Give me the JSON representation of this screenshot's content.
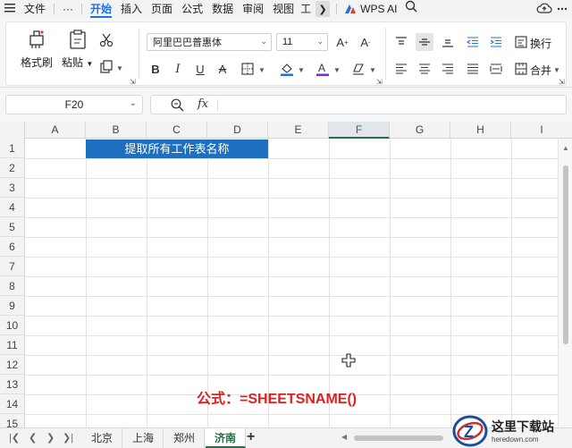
{
  "menubar": {
    "items": [
      {
        "label": "文件"
      },
      {
        "label": "开始",
        "active": true
      },
      {
        "label": "插入"
      },
      {
        "label": "页面"
      },
      {
        "label": "公式"
      },
      {
        "label": "数据"
      },
      {
        "label": "审阅"
      },
      {
        "label": "视图"
      },
      {
        "label": "工"
      }
    ],
    "more": "···",
    "wps_ai": "WPS AI"
  },
  "ribbon": {
    "format_painter": "格式刷",
    "paste": "粘贴",
    "font_name": "阿里巴巴普惠体",
    "font_size": "11",
    "wrap_text": "换行",
    "merge": "合并"
  },
  "formula_bar": {
    "cell_ref": "F20",
    "fx": "fx"
  },
  "sheet": {
    "columns": [
      "A",
      "B",
      "C",
      "D",
      "E",
      "F",
      "G",
      "H",
      "I"
    ],
    "selected_column": "F",
    "rows": [
      "1",
      "2",
      "3",
      "4",
      "5",
      "6",
      "7",
      "8",
      "9",
      "10",
      "11",
      "12",
      "13",
      "14",
      "15"
    ],
    "title_cell_text": "提取所有工作表名称",
    "formula_note": "公式：=SHEETSNAME()"
  },
  "tabs": {
    "sheets": [
      "北京",
      "上海",
      "郑州",
      "济南"
    ],
    "active": "济南",
    "add": "+"
  },
  "watermark": {
    "title": "这里下载站",
    "url": "heredown.com"
  },
  "colors": {
    "accent": "#1a73e8",
    "title_fill": "#1e6fbf",
    "formula_text": "#e02020",
    "sheet_active": "#217346"
  }
}
